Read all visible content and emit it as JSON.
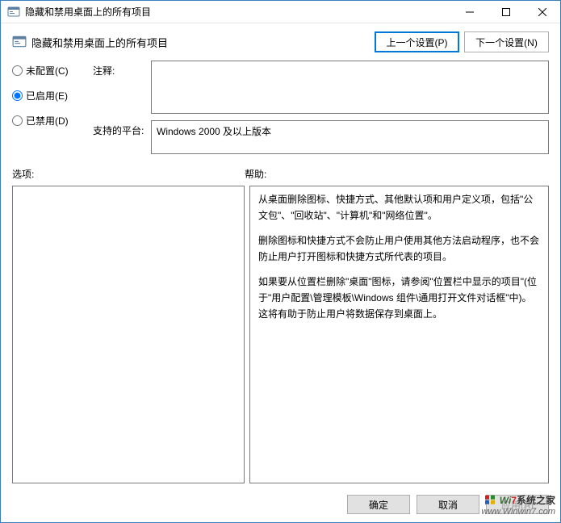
{
  "titlebar": {
    "title": "隐藏和禁用桌面上的所有项目"
  },
  "header": {
    "setting_name": "隐藏和禁用桌面上的所有项目",
    "prev_label": "上一个设置(P)",
    "next_label": "下一个设置(N)"
  },
  "radios": {
    "not_configured": "未配置(C)",
    "enabled": "已启用(E)",
    "disabled": "已禁用(D)",
    "selected": "enabled"
  },
  "fields": {
    "comment_label": "注释:",
    "comment_value": "",
    "supported_label": "支持的平台:",
    "supported_value": "Windows 2000 及以上版本"
  },
  "labels": {
    "options": "选项:",
    "help": "帮助:"
  },
  "help": {
    "p1": "从桌面删除图标、快捷方式、其他默认项和用户定义项，包括\"公文包\"、\"回收站\"、\"计算机\"和\"网络位置\"。",
    "p2": "删除图标和快捷方式不会防止用户使用其他方法启动程序，也不会防止用户打开图标和快捷方式所代表的项目。",
    "p3": "如果要从位置栏删除\"桌面\"图标，请参阅\"位置栏中显示的项目\"(位于\"用户配置\\管理模板\\Windows 组件\\通用打开文件对话框\"中)。这将有助于防止用户将数据保存到桌面上。"
  },
  "footer": {
    "ok": "确定",
    "cancel": "取消",
    "apply": "应用(A)"
  },
  "watermark": {
    "line1_num": "7",
    "line1_text": "系统之家",
    "line2": "www.Winwin7.com",
    "prefix": "Wi"
  }
}
